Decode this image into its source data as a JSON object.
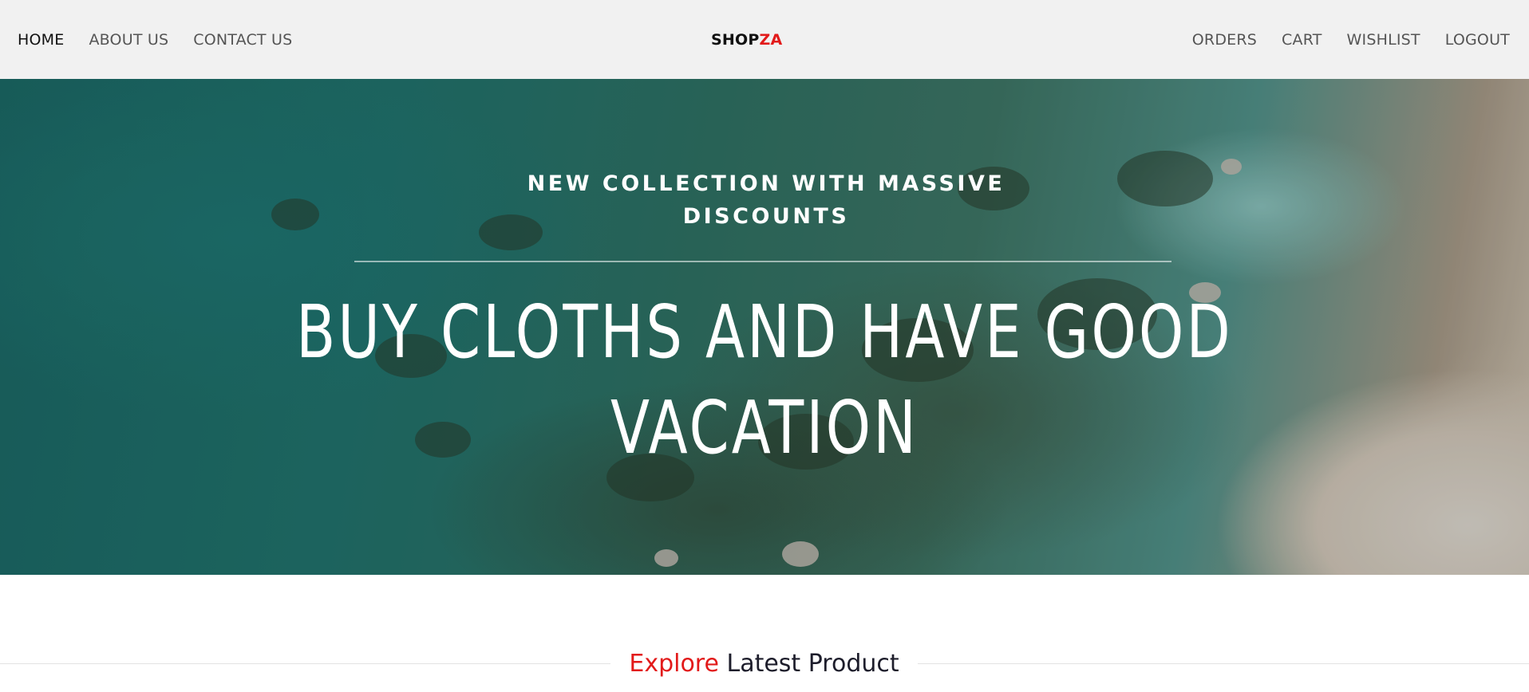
{
  "nav": {
    "left": [
      {
        "label": "HOME",
        "active": true
      },
      {
        "label": "ABOUT US",
        "active": false
      },
      {
        "label": "CONTACT US",
        "active": false
      }
    ],
    "brand": {
      "part1": "SHOP",
      "part2": "ZA",
      "accent_color": "#e21a1a"
    },
    "right": [
      {
        "label": "ORDERS"
      },
      {
        "label": "CART"
      },
      {
        "label": "WISHLIST"
      },
      {
        "label": "LOGOUT"
      }
    ]
  },
  "hero": {
    "subtitle_line1": "NEW COLLECTION WITH MASSIVE",
    "subtitle_line2": "DISCOUNTS",
    "title": "BUY CLOTHS AND HAVE GOOD VACATION"
  },
  "explore": {
    "accent_word": "Explore",
    "rest": "Latest Product"
  }
}
